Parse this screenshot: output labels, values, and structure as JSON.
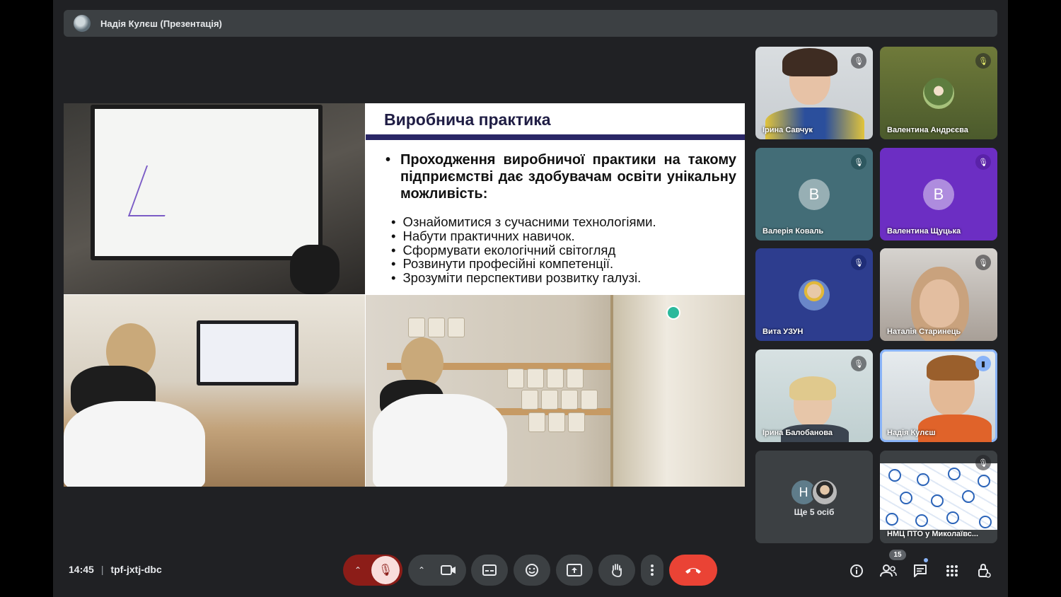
{
  "meeting": {
    "presenter_label": "Надія Кулєш (Презентація)",
    "time": "14:45",
    "code": "tpf-jxtj-dbc",
    "separator": "|"
  },
  "slide": {
    "title": "Виробнича практика",
    "lead_bullet": "•",
    "lead": "Проходження виробничої практики на такому підприємстві дає здобувачам освіти унікальну можливість:",
    "bullets": [
      "Ознайомитися з сучасними технологіями.",
      "Набути практичних навичок.",
      "Сформувати екологічний світогляд",
      "Розвинути професійні компетенції.",
      "Зрозуміти перспективи розвитку галузі."
    ]
  },
  "participants": [
    {
      "name": "Ірина Савчук",
      "mic": "muted"
    },
    {
      "name": "Валентина Андрєєва",
      "mic": "muted"
    },
    {
      "name": "Валерія Коваль",
      "initial": "В",
      "mic": "muted"
    },
    {
      "name": "Валентина Щуцька",
      "initial": "В",
      "mic": "muted"
    },
    {
      "name": "Вита УЗУН",
      "mic": "muted"
    },
    {
      "name": "Наталія Старинець",
      "mic": "muted"
    },
    {
      "name": "Ірина Балобанова",
      "mic": "muted"
    },
    {
      "name": "Надія Кулєш",
      "mic": "speaking"
    },
    {
      "more_initial": "Н",
      "more_label": "Ще 5 осіб"
    },
    {
      "name": "НМЦ ПТО у Миколаївс...",
      "mic": "muted"
    }
  ],
  "controls": {
    "people_count": "15",
    "end_call_color": "#ea4335",
    "mic_muted_color": "#f9dedc",
    "accent": "#8ab4f8"
  },
  "icons": [
    "mic-off-icon",
    "camera-icon",
    "captions-icon",
    "emoji-icon",
    "present-icon",
    "raise-hand-icon",
    "more-icon",
    "end-call-icon",
    "info-icon",
    "people-icon",
    "chat-icon",
    "activities-icon",
    "host-controls-icon"
  ]
}
